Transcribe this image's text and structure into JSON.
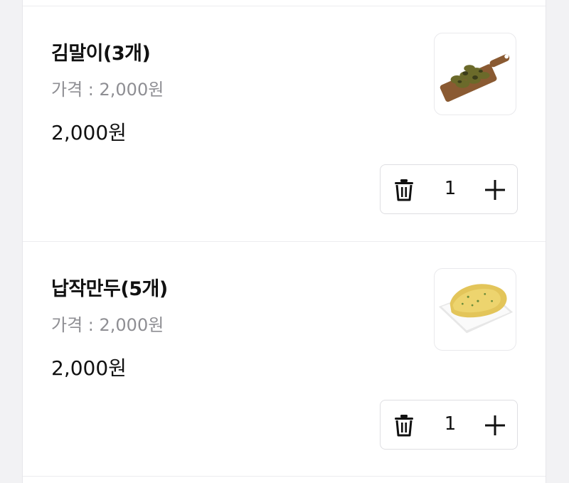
{
  "cart": {
    "items": [
      {
        "name": "김말이(3개)",
        "price_label": "가격 : 2,000원",
        "total": "2,000원",
        "quantity": "1",
        "image_icon": "fried-seaweed-roll-image"
      },
      {
        "name": "납작만두(5개)",
        "price_label": "가격 : 2,000원",
        "total": "2,000원",
        "quantity": "1",
        "image_icon": "flat-dumpling-image"
      }
    ]
  }
}
